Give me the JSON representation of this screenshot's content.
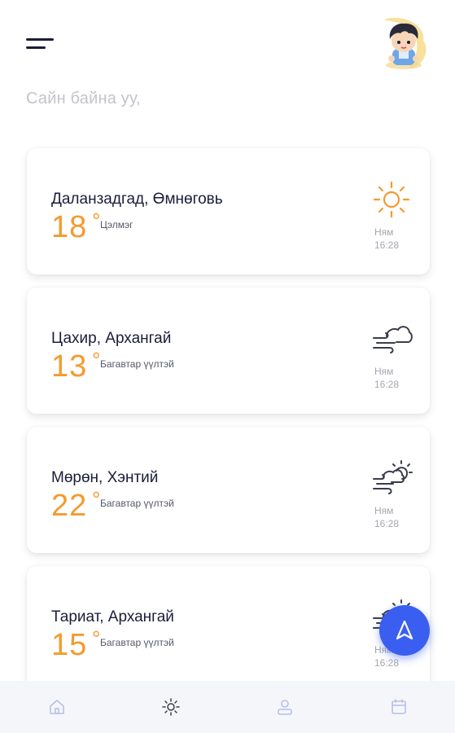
{
  "header": {
    "greeting": "Сайн байна уу,"
  },
  "locations": [
    {
      "city": "Даланзадгад, Өмнөговь",
      "temp": "18",
      "unit": "°",
      "condition": "Цэлмэг",
      "day": "Ням",
      "time": "16:28",
      "icon": "sun-icon"
    },
    {
      "city": "Цахир, Архангай",
      "temp": "13",
      "unit": "°",
      "condition": "Багавтар үүлтэй",
      "day": "Ням",
      "time": "16:28",
      "icon": "wind-cloud-icon"
    },
    {
      "city": "Мөрөн, Хэнтий",
      "temp": "22",
      "unit": "°",
      "condition": "Багавтар үүлтэй",
      "day": "Ням",
      "time": "16:28",
      "icon": "wind-cloud-sun-icon"
    },
    {
      "city": "Тариат, Архангай",
      "temp": "15",
      "unit": "°",
      "condition": "Багавтар үүлтэй",
      "day": "Ням",
      "time": "16:28",
      "icon": "wind-cloud-sun-icon"
    }
  ],
  "colors": {
    "accent_temp": "#f59a2e",
    "title_text": "#1b1d3a",
    "fab": "#3a5ff0",
    "nav_icon": "#b7bfe8"
  },
  "bottom_nav": [
    "home-icon",
    "sun-icon",
    "profile-icon",
    "calendar-icon"
  ]
}
